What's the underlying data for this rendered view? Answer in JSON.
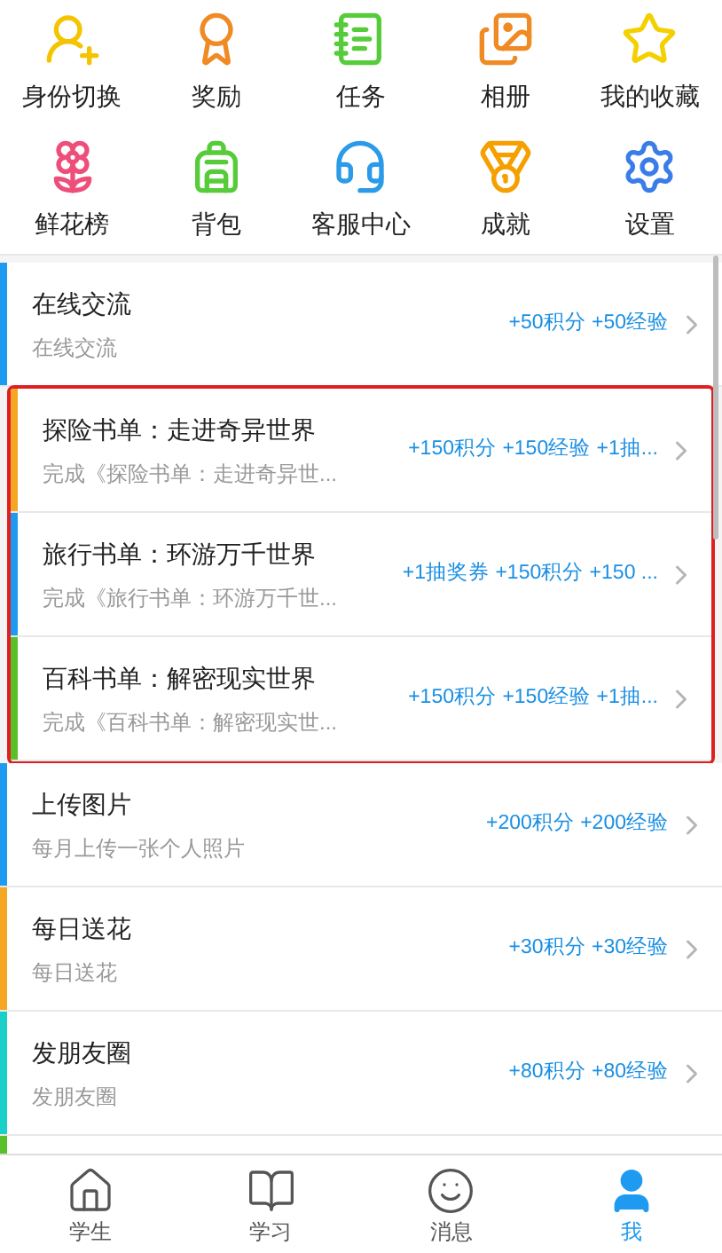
{
  "shortcuts": [
    {
      "label": "身份切换"
    },
    {
      "label": "奖励"
    },
    {
      "label": "任务"
    },
    {
      "label": "相册"
    },
    {
      "label": "我的收藏"
    },
    {
      "label": "鲜花榜"
    },
    {
      "label": "背包"
    },
    {
      "label": "客服中心"
    },
    {
      "label": "成就"
    },
    {
      "label": "设置"
    }
  ],
  "tasks": [
    {
      "title": "在线交流",
      "subtitle": "在线交流",
      "rewards": "+50积分 +50经验",
      "color": "#1e9bf0",
      "highlighted": false
    },
    {
      "title": "探险书单：走进奇异世界",
      "subtitle": "完成《探险书单：走进奇异世...",
      "rewards": "+150积分 +150经验 +1抽...",
      "color": "#f5a623",
      "highlighted": true
    },
    {
      "title": "旅行书单：环游万千世界",
      "subtitle": "完成《旅行书单：环游万千世...",
      "rewards": "+1抽奖券 +150积分 +150 ...",
      "color": "#1e9bf0",
      "highlighted": true
    },
    {
      "title": "百科书单：解密现实世界",
      "subtitle": "完成《百科书单：解密现实世...",
      "rewards": "+150积分 +150经验 +1抽...",
      "color": "#5ac02a",
      "highlighted": true
    },
    {
      "title": "上传图片",
      "subtitle": "每月上传一张个人照片",
      "rewards": "+200积分 +200经验",
      "color": "#1e9bf0",
      "highlighted": false
    },
    {
      "title": "每日送花",
      "subtitle": "每日送花",
      "rewards": "+30积分 +30经验",
      "color": "#f5a623",
      "highlighted": false
    },
    {
      "title": "发朋友圈",
      "subtitle": "发朋友圈",
      "rewards": "+80积分 +80经验",
      "color": "#19cfc8",
      "highlighted": false
    }
  ],
  "clipped_row": {
    "color": "#5ac02a"
  },
  "tab_bar": [
    {
      "label": "学生",
      "selected": false
    },
    {
      "label": "学习",
      "selected": false
    },
    {
      "label": "消息",
      "selected": false
    },
    {
      "label": "我",
      "selected": true
    }
  ]
}
